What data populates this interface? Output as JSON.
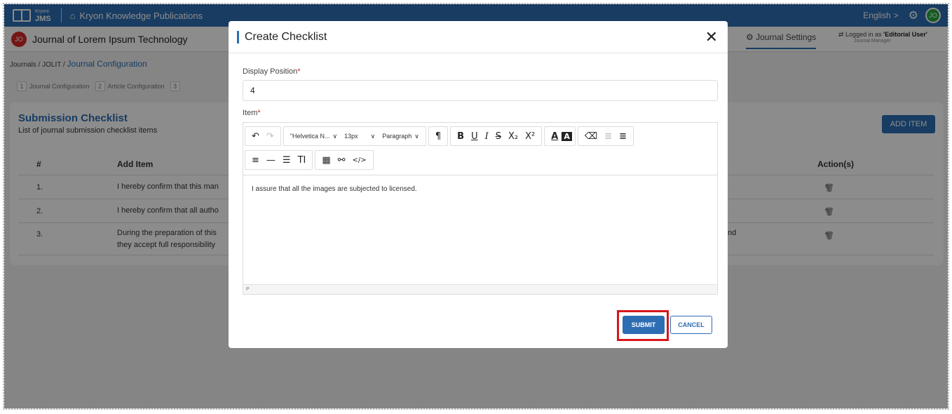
{
  "topbar": {
    "logo_brand": "Kryoni",
    "logo_app": "JMS",
    "org_name": "Kryon Knowledge Publications",
    "language": "English",
    "language_chevron": ">",
    "user_initials": "JO",
    "icons": {
      "home": "home-icon",
      "settings": "gear-icon"
    }
  },
  "journal_bar": {
    "initials": "JO",
    "title": "Journal of Lorem Ipsum Technology",
    "settings_label": "Journal Settings",
    "logged_prefix": "Logged in as ",
    "logged_role": "'Editorial User'",
    "logged_sub": "Journal Manager"
  },
  "breadcrumb": {
    "items": [
      "Journals",
      "JOLIT",
      "Journal Configuration"
    ],
    "separator": "/"
  },
  "steps": [
    {
      "num": "1",
      "label": "Journal Configuration"
    },
    {
      "num": "2",
      "label": "Article Configuration"
    },
    {
      "num": "3",
      "label": ""
    }
  ],
  "card": {
    "title": "Submission Checklist",
    "subtitle": "List of journal submission checklist items",
    "add_button": "ADD ITEM",
    "columns": [
      "#",
      "Add Item",
      "Action(s)"
    ],
    "rows": [
      {
        "num": "1.",
        "text": "I hereby confirm that this man",
        "text2": "",
        "tail": ""
      },
      {
        "num": "2.",
        "text": "I hereby confirm that all autho",
        "text2": "",
        "tail": ""
      },
      {
        "num": "3.",
        "text": "During the preparation of this",
        "text2": "they accept full responsibility",
        "tail": "nd"
      }
    ],
    "row_actions": [
      "edit-icon",
      "delete-icon"
    ]
  },
  "modal": {
    "title": "Create Checklist",
    "close": "✕",
    "position_label": "Display Position",
    "position_value": "4",
    "item_label": "Item",
    "required_mark": "*",
    "toolbar": {
      "font_family": "\"Helvetica N...",
      "font_size": "13px",
      "block": "Paragraph",
      "buttons_row1": [
        "undo",
        "redo",
        "paragraph",
        "bold",
        "underline",
        "italic",
        "strikethrough",
        "subscript",
        "superscript",
        "text-color",
        "background-color",
        "clear-format",
        "outdent",
        "indent"
      ],
      "buttons_row2": [
        "align-left",
        "horizontal-rule",
        "ordered-list",
        "text-size",
        "table",
        "link",
        "code"
      ]
    },
    "content": "I assure that all the images are subjected to licensed.",
    "status_path": "P",
    "submit": "SUBMIT",
    "cancel": "CANCEL"
  },
  "colors": {
    "primary": "#2d6db3",
    "highlight_border": "#d6171c",
    "danger_avatar": "#d62828",
    "success_avatar": "#26a743"
  }
}
